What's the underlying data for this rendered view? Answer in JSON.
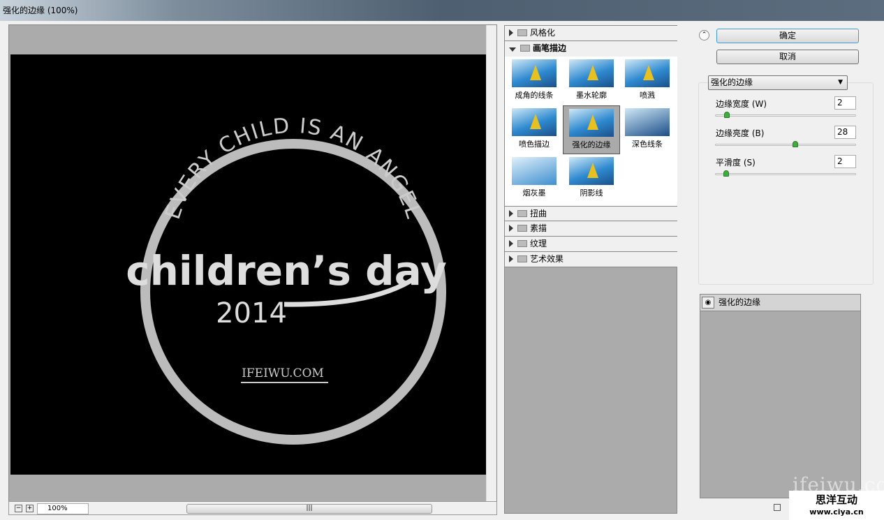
{
  "window": {
    "title": "强化的边缘 (100%)"
  },
  "preview": {
    "zoom": "100%",
    "zoom_out": "−",
    "zoom_in": "+",
    "image_text": {
      "arc": "EVERY CHILD IS AN ANGEL",
      "main": "children’s day",
      "year": "2014",
      "site": "IFEIWU.COM"
    }
  },
  "filters": {
    "categories": [
      {
        "label": "风格化",
        "expanded": false
      },
      {
        "label": "画笔描边",
        "expanded": true
      },
      {
        "label": "扭曲",
        "expanded": false
      },
      {
        "label": "素描",
        "expanded": false
      },
      {
        "label": "纹理",
        "expanded": false
      },
      {
        "label": "艺术效果",
        "expanded": false
      }
    ],
    "brush_items": [
      "成角的线条",
      "墨水轮廓",
      "喷溅",
      "喷色描边",
      "强化的边缘",
      "深色线条",
      "烟灰墨",
      "阴影线"
    ],
    "selected": "强化的边缘"
  },
  "controls": {
    "ok": "确定",
    "cancel": "取消",
    "filter_select": "强化的边缘",
    "params": [
      {
        "label": "边缘宽度 (W)",
        "value": "2",
        "min": 1,
        "max": 10
      },
      {
        "label": "边缘亮度 (B)",
        "value": "28",
        "min": 0,
        "max": 50
      },
      {
        "label": "平滑度 (S)",
        "value": "2",
        "min": 1,
        "max": 15
      }
    ]
  },
  "layers": {
    "items": [
      {
        "name": "强化的边缘",
        "visible": true
      }
    ]
  },
  "watermarks": {
    "site": "ifeiwu.com",
    "brand": "思洋互动",
    "url": "www.ciya.cn"
  }
}
